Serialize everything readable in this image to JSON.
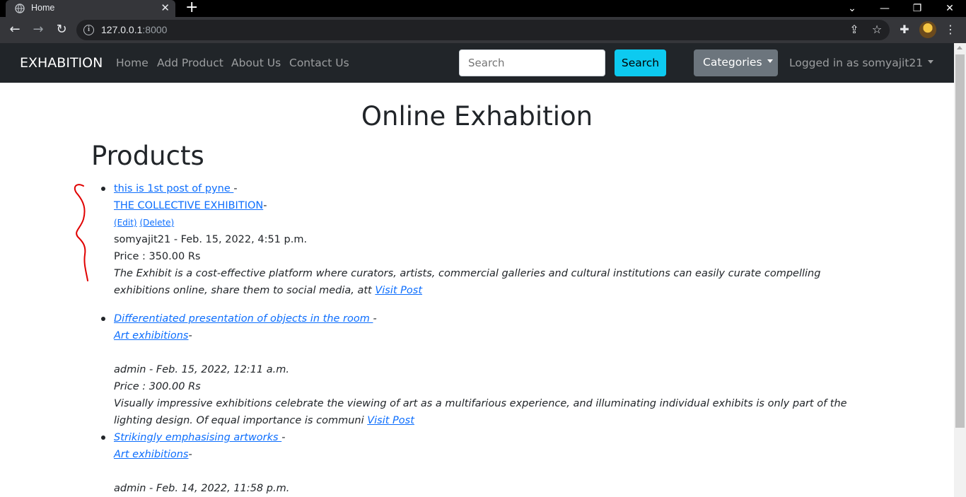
{
  "browser": {
    "tab_title": "Home",
    "url_host": "127.0.0.1",
    "url_port": ":8000"
  },
  "navbar": {
    "brand": "EXHABITION",
    "links": [
      "Home",
      "Add Product",
      "About Us",
      "Contact Us"
    ],
    "search_placeholder": "Search",
    "search_button": "Search",
    "categories_button": "Categories",
    "user_menu": "Logged in as somyajit21"
  },
  "main": {
    "title": "Online Exhabition",
    "section_heading": "Products",
    "products": [
      {
        "title": "this is 1st post of pyne ",
        "category": "THE COLLECTIVE EXHIBITION",
        "edit": "(Edit)",
        "delete": "(Delete)",
        "meta": "somyajit21 - Feb. 15, 2022, 4:51 p.m.",
        "price": "Price : 350.00 Rs",
        "excerpt": "The Exhibit is a cost-effective platform where curators, artists, commercial galleries and cultural institutions can easily curate compelling exhibitions online, share them to social media, att",
        "visit": "Visit Post"
      },
      {
        "title": "Differentiated presentation of objects in the room ",
        "category": "Art exhibitions",
        "meta": "admin - Feb. 15, 2022, 12:11 a.m.",
        "price": "Price : 300.00 Rs",
        "excerpt": "Visually impressive exhibitions celebrate the viewing of art as a multifarious experience, and illuminating individual exhibits is only part of the lighting design. Of equal importance is communi",
        "visit": "Visit Post"
      },
      {
        "title": "Strikingly emphasising artworks ",
        "category": "Art exhibitions",
        "meta": "admin - Feb. 14, 2022, 11:58 p.m."
      }
    ]
  },
  "colors": {
    "navbar_bg": "#212529",
    "link": "#0d6efd",
    "search_btn": "#0dcaf0",
    "categories_btn": "#6c757d",
    "annotation": "#e00000"
  }
}
